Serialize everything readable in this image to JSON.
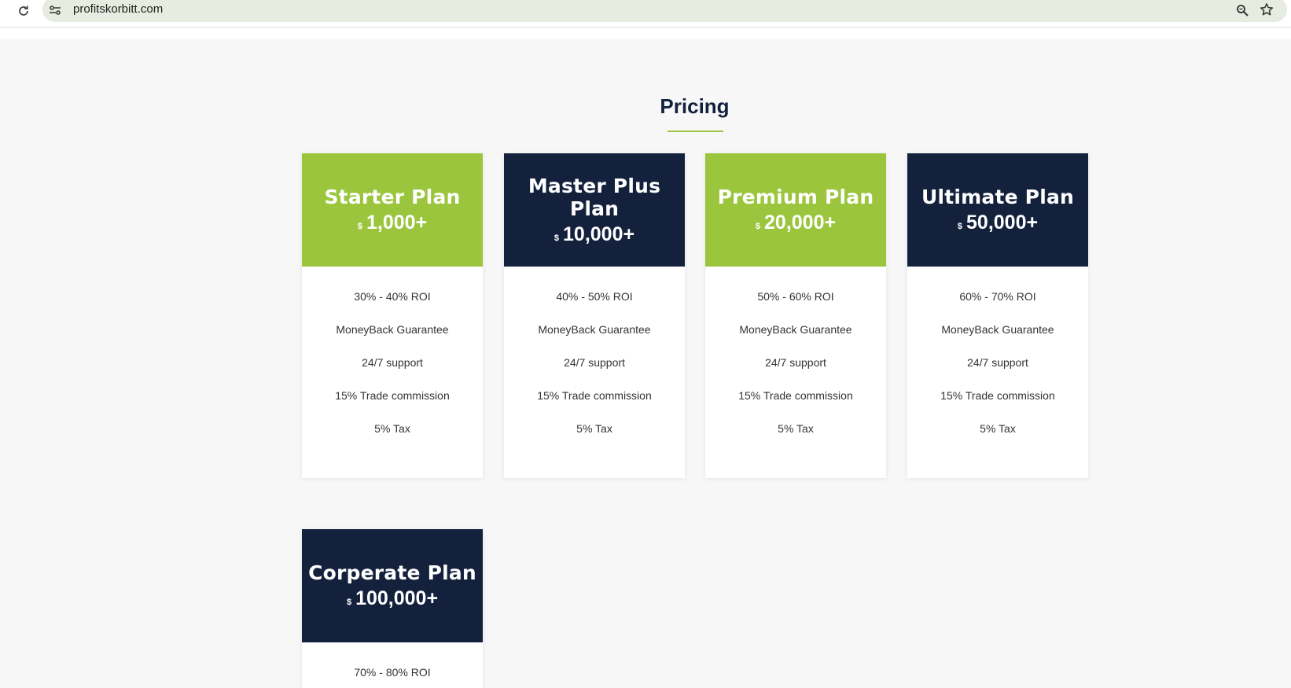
{
  "browser": {
    "url": "profitskorbitt.com",
    "icons": [
      "reload-icon",
      "site-settings-icon",
      "zoom-icon",
      "bookmark-star-icon"
    ]
  },
  "pricing": {
    "title": "Pricing",
    "accent_color": "#9bc53d",
    "dark_color": "#14213d",
    "plans": [
      {
        "name": "Starter Plan",
        "currency": "$",
        "price": "1,000+",
        "theme": "green",
        "features": [
          "30% - 40% ROI",
          "MoneyBack Guarantee",
          "24/7 support",
          "15% Trade commission",
          "5% Tax"
        ]
      },
      {
        "name": "Master Plus Plan",
        "currency": "$",
        "price": "10,000+",
        "theme": "navy",
        "features": [
          "40% - 50% ROI",
          "MoneyBack Guarantee",
          "24/7 support",
          "15% Trade commission",
          "5% Tax"
        ]
      },
      {
        "name": "Premium Plan",
        "currency": "$",
        "price": "20,000+",
        "theme": "green",
        "features": [
          "50% - 60% ROI",
          "MoneyBack Guarantee",
          "24/7 support",
          "15% Trade commission",
          "5% Tax"
        ]
      },
      {
        "name": "Ultimate Plan",
        "currency": "$",
        "price": "50,000+",
        "theme": "navy",
        "features": [
          "60% - 70% ROI",
          "MoneyBack Guarantee",
          "24/7 support",
          "15% Trade commission",
          "5% Tax"
        ]
      },
      {
        "name": "Corperate Plan",
        "currency": "$",
        "price": "100,000+",
        "theme": "navy",
        "features": [
          "70% - 80% ROI"
        ]
      }
    ]
  }
}
